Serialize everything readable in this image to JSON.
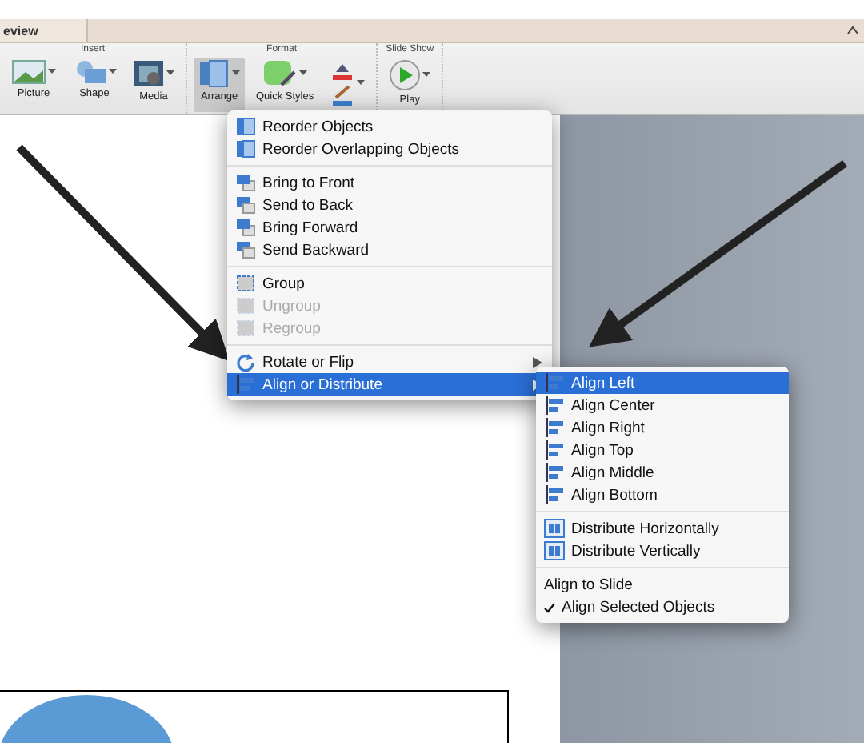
{
  "tab": {
    "label": "eview"
  },
  "ribbon_groups": [
    {
      "title": "Insert",
      "buttons": [
        {
          "label": "Picture",
          "kind": "picture",
          "selected": false
        },
        {
          "label": "Shape",
          "kind": "shape",
          "selected": false
        },
        {
          "label": "Media",
          "kind": "media",
          "selected": false
        }
      ]
    },
    {
      "title": "Format",
      "buttons": [
        {
          "label": "Arrange",
          "kind": "arrange",
          "selected": true
        },
        {
          "label": "Quick Styles",
          "kind": "styles",
          "selected": false
        },
        {
          "kind": "fill-line",
          "selected": false
        }
      ]
    },
    {
      "title": "Slide Show",
      "buttons": [
        {
          "label": "Play",
          "kind": "play",
          "selected": false
        }
      ]
    }
  ],
  "menu": {
    "sections": [
      [
        {
          "label": "Reorder Objects",
          "kind": "reorder",
          "disabled": false,
          "selected": false,
          "submenu": false
        },
        {
          "label": "Reorder Overlapping Objects",
          "kind": "reorder",
          "disabled": false,
          "selected": false,
          "submenu": false
        }
      ],
      [
        {
          "label": "Bring to Front",
          "kind": "front",
          "disabled": false,
          "selected": false,
          "submenu": false
        },
        {
          "label": "Send to Back",
          "kind": "back",
          "disabled": false,
          "selected": false,
          "submenu": false
        },
        {
          "label": "Bring Forward",
          "kind": "front",
          "disabled": false,
          "selected": false,
          "submenu": false
        },
        {
          "label": "Send Backward",
          "kind": "back",
          "disabled": false,
          "selected": false,
          "submenu": false
        }
      ],
      [
        {
          "label": "Group",
          "kind": "group",
          "disabled": false,
          "selected": false,
          "submenu": false
        },
        {
          "label": "Ungroup",
          "kind": "group",
          "disabled": true,
          "selected": false,
          "submenu": false
        },
        {
          "label": "Regroup",
          "kind": "group",
          "disabled": true,
          "selected": false,
          "submenu": false
        }
      ],
      [
        {
          "label": "Rotate or Flip",
          "kind": "rotate",
          "disabled": false,
          "selected": false,
          "submenu": true
        },
        {
          "label": "Align or Distribute",
          "kind": "align",
          "disabled": false,
          "selected": true,
          "submenu": true
        }
      ]
    ]
  },
  "submenu": {
    "sections": [
      [
        {
          "label": "Align Left",
          "kind": "align",
          "selected": true,
          "checked": false
        },
        {
          "label": "Align Center",
          "kind": "align",
          "selected": false,
          "checked": false
        },
        {
          "label": "Align Right",
          "kind": "align",
          "selected": false,
          "checked": false
        },
        {
          "label": "Align Top",
          "kind": "align",
          "selected": false,
          "checked": false
        },
        {
          "label": "Align Middle",
          "kind": "align",
          "selected": false,
          "checked": false
        },
        {
          "label": "Align Bottom",
          "kind": "align",
          "selected": false,
          "checked": false
        }
      ],
      [
        {
          "label": "Distribute Horizontally",
          "kind": "distribute",
          "selected": false,
          "checked": false
        },
        {
          "label": "Distribute Vertically",
          "kind": "distribute",
          "selected": false,
          "checked": false
        }
      ],
      [
        {
          "label": "Align to Slide",
          "kind": "text",
          "selected": false,
          "checked": false
        },
        {
          "label": "Align Selected Objects",
          "kind": "text",
          "selected": false,
          "checked": true
        }
      ]
    ]
  }
}
